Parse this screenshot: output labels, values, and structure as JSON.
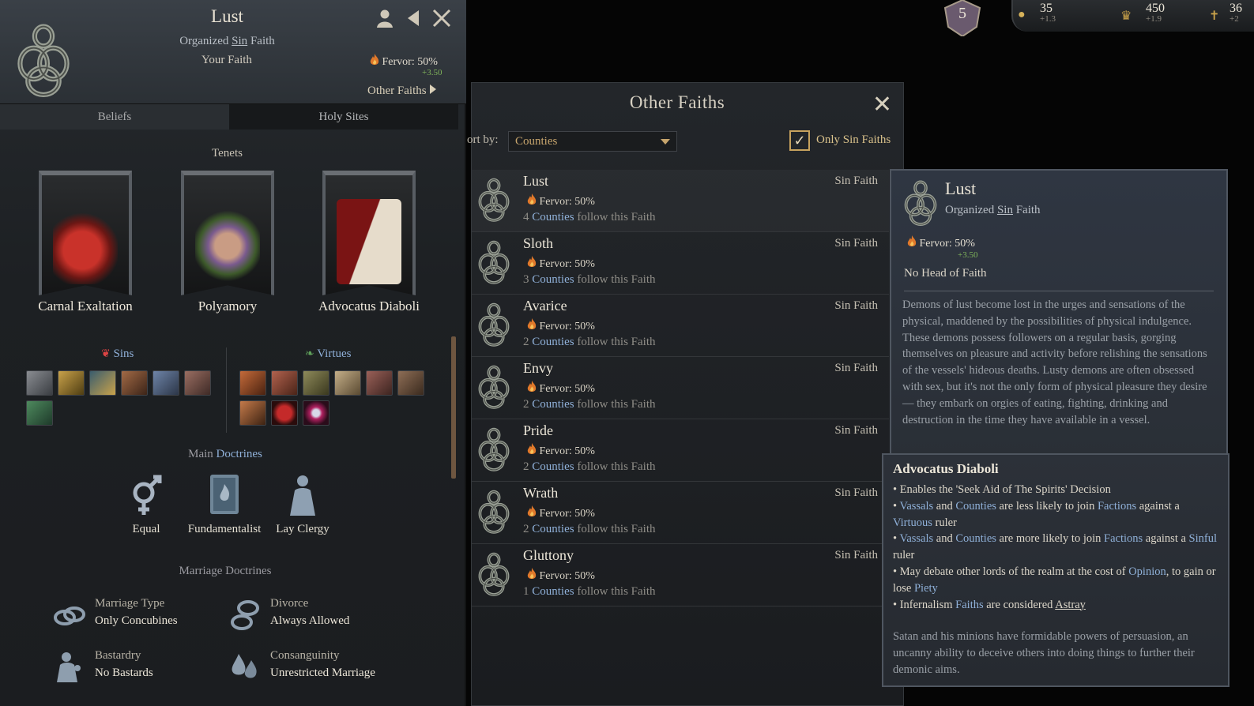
{
  "faith_panel": {
    "title": "Lust",
    "subtitle_prefix": "Organized ",
    "subtitle_link": "Sin",
    "subtitle_suffix": " Faith",
    "your_faith": "Your Faith",
    "fervor_label": "Fervor",
    "fervor_value": ": 50%",
    "fervor_change": "+3.50",
    "other_faiths_link": "Other Faiths",
    "tabs": [
      "Beliefs",
      "Holy Sites"
    ],
    "tenets_label": "Tenets",
    "tenets": [
      "Carnal Exaltation",
      "Polyamory",
      "Advocatus Diaboli"
    ],
    "sins_label": "Sins",
    "virtues_label": "Virtues",
    "main_doctrines_prefix": "Main ",
    "main_doctrines_link": "Doctrines",
    "main_doctrines": [
      "Equal",
      "Fundamentalist",
      "Lay Clergy"
    ],
    "marriage_doctrines_label": "Marriage Doctrines",
    "marriage_doctrines": [
      {
        "label": "Marriage Type",
        "value": "Only Concubines"
      },
      {
        "label": "Divorce",
        "value": "Always Allowed"
      },
      {
        "label": "Bastardry",
        "value": "No Bastards"
      },
      {
        "label": "Consanguinity",
        "value": "Unrestricted Marriage"
      }
    ]
  },
  "hud": {
    "dynasty_level": "5",
    "gold": "35",
    "gold_change": "+1.3",
    "prestige": "450",
    "prestige_change": "+1.9",
    "piety": "36",
    "piety_change": "+2"
  },
  "other_faiths": {
    "title": "Other Faiths",
    "sort_label": "ort by:",
    "sort_value": "Counties",
    "only_sin_label": "Only Sin Faiths",
    "type_label": "Sin Faith",
    "fervor_label": "Fervor: 50%",
    "counties_link": "Counties",
    "counties_suffix": " follow this Faith",
    "rows": [
      {
        "name": "Lust",
        "count": "4"
      },
      {
        "name": "Sloth",
        "count": "3"
      },
      {
        "name": "Avarice",
        "count": "2"
      },
      {
        "name": "Envy",
        "count": "2"
      },
      {
        "name": "Pride",
        "count": "2"
      },
      {
        "name": "Wrath",
        "count": "2"
      },
      {
        "name": "Gluttony",
        "count": "1"
      }
    ]
  },
  "tooltip_faith": {
    "name": "Lust",
    "subtitle_prefix": "Organized ",
    "subtitle_link": "Sin",
    "subtitle_suffix": " Faith",
    "fervor": "Fervor: 50%",
    "fervor_change": "+3.50",
    "head": "No Head of Faith",
    "description": "Demons of lust become lost in the urges and sensations of the physical, maddened by the possibilities of physical indulgence. These demons possess followers on a regular basis, gorging themselves on pleasure and activity before relishing the sensations of the vessels' hideous deaths. Lusty demons are often obsessed with sex, but it's not the only form of physical pleasure they desire — they embark on orgies of eating, fighting, drinking and destruction in the time they have available in a vessel."
  },
  "tooltip_tenet": {
    "title": "Advocatus Diaboli",
    "effect_1": "• Enables the 'Seek Aid of The Spirits' Decision",
    "e2_bullet": "• ",
    "e2_vassals": "Vassals",
    "e2_and": " and ",
    "e2_counties": "Counties",
    "e2_mid": " are less likely to join ",
    "e2_factions": "Factions",
    "e2_against": " against a ",
    "e2_target": "Virtuous",
    "e2_ruler": " ruler",
    "e3_bullet": "• ",
    "e3_vassals": "Vassals",
    "e3_and": " and ",
    "e3_counties": "Counties",
    "e3_mid": " are more likely to join ",
    "e3_factions": "Factions",
    "e3_against": " against a ",
    "e3_target": "Sinful",
    "e3_ruler": " ruler",
    "e4_start": "• May debate other lords of the realm at the cost of ",
    "e4_opinion": "Opinion",
    "e4_mid": ", to gain or lose ",
    "e4_piety": "Piety",
    "e5_start": "• Infernalism ",
    "e5_faiths": "Faiths",
    "e5_mid": " are considered ",
    "e5_astray": "Astray",
    "flavor": "Satan and his minions have formidable powers of persuasion, an uncanny ability to deceive others into doing things to further their demonic aims."
  },
  "colors": {
    "link": "#8fb0d8",
    "positive": "#7fb35a",
    "accent_gold": "#c7a56d",
    "panel_bg": "#1d2023"
  },
  "icons": {
    "faith_emblem": "knot-emblem-icon",
    "fervor": "flame-icon",
    "sins": "demon-face-icon",
    "virtues": "laurel-icon"
  }
}
